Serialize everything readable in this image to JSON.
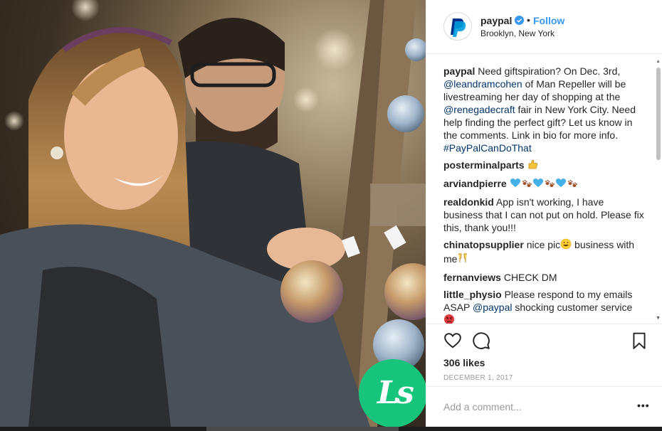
{
  "post": {
    "username": "paypal",
    "follow_label": "Follow",
    "dot": "•",
    "location": "Brooklyn, New York",
    "avatar_icon": "paypal-logo-icon",
    "verified_icon": "verified-badge-icon"
  },
  "caption": {
    "user": "paypal",
    "parts": [
      {
        "type": "text",
        "text": "Need giftspiration? On Dec. 3rd, "
      },
      {
        "type": "mention",
        "text": "@leandramcohen"
      },
      {
        "type": "text",
        "text": " of Man Repeller will be livestreaming her day of shopping at the "
      },
      {
        "type": "mention",
        "text": "@renegadecraft"
      },
      {
        "type": "text",
        "text": " fair in New York City. Need help finding the perfect gift? Let us know in the comments. Link in bio for more info. "
      },
      {
        "type": "tag",
        "text": "#PayPalCanDoThat"
      }
    ]
  },
  "comments": [
    {
      "user": "posterminalparts",
      "parts": [
        {
          "type": "emoji",
          "icon": "thumbs-up-emoji"
        }
      ]
    },
    {
      "user": "arviandpierre",
      "parts": [
        {
          "type": "emoji",
          "icon": "blue-heart-emoji"
        },
        {
          "type": "emoji",
          "icon": "paw-prints-emoji"
        },
        {
          "type": "emoji",
          "icon": "blue-heart-emoji"
        },
        {
          "type": "emoji",
          "icon": "paw-prints-emoji"
        },
        {
          "type": "emoji",
          "icon": "blue-heart-emoji"
        },
        {
          "type": "emoji",
          "icon": "paw-prints-emoji"
        }
      ]
    },
    {
      "user": "realdonkid",
      "parts": [
        {
          "type": "text",
          "text": "App isn't working, I have business that I can not put on hold. Please fix this, thank you!!!"
        }
      ]
    },
    {
      "user": "chinatopsupplier",
      "parts": [
        {
          "type": "text",
          "text": "nice pic"
        },
        {
          "type": "emoji",
          "icon": "grinning-face-emoji"
        },
        {
          "type": "text",
          "text": "  business with me"
        },
        {
          "type": "emoji",
          "icon": "clinking-glasses-emoji"
        }
      ]
    },
    {
      "user": "fernanviews",
      "parts": [
        {
          "type": "text",
          "text": "CHECK DM"
        }
      ]
    },
    {
      "user": "little_physio",
      "parts": [
        {
          "type": "text",
          "text": "Please respond to my emails ASAP "
        },
        {
          "type": "mention",
          "text": "@paypal"
        },
        {
          "type": "text",
          "text": " shocking customer service "
        },
        {
          "type": "emoji",
          "icon": "angry-face-emoji"
        }
      ]
    }
  ],
  "actions": {
    "like_icon": "heart-icon",
    "comment_icon": "comment-bubble-icon",
    "save_icon": "bookmark-icon"
  },
  "likes": "306 likes",
  "date": "DECEMBER 1, 2017",
  "add_comment": {
    "placeholder": "Add a comment...",
    "more": "•••"
  },
  "badge": {
    "text": "Ls",
    "color": "#17c47c"
  },
  "colors": {
    "link": "#003569",
    "follow": "#3897f0",
    "paypal_dark": "#003087",
    "paypal_light": "#009cde"
  }
}
